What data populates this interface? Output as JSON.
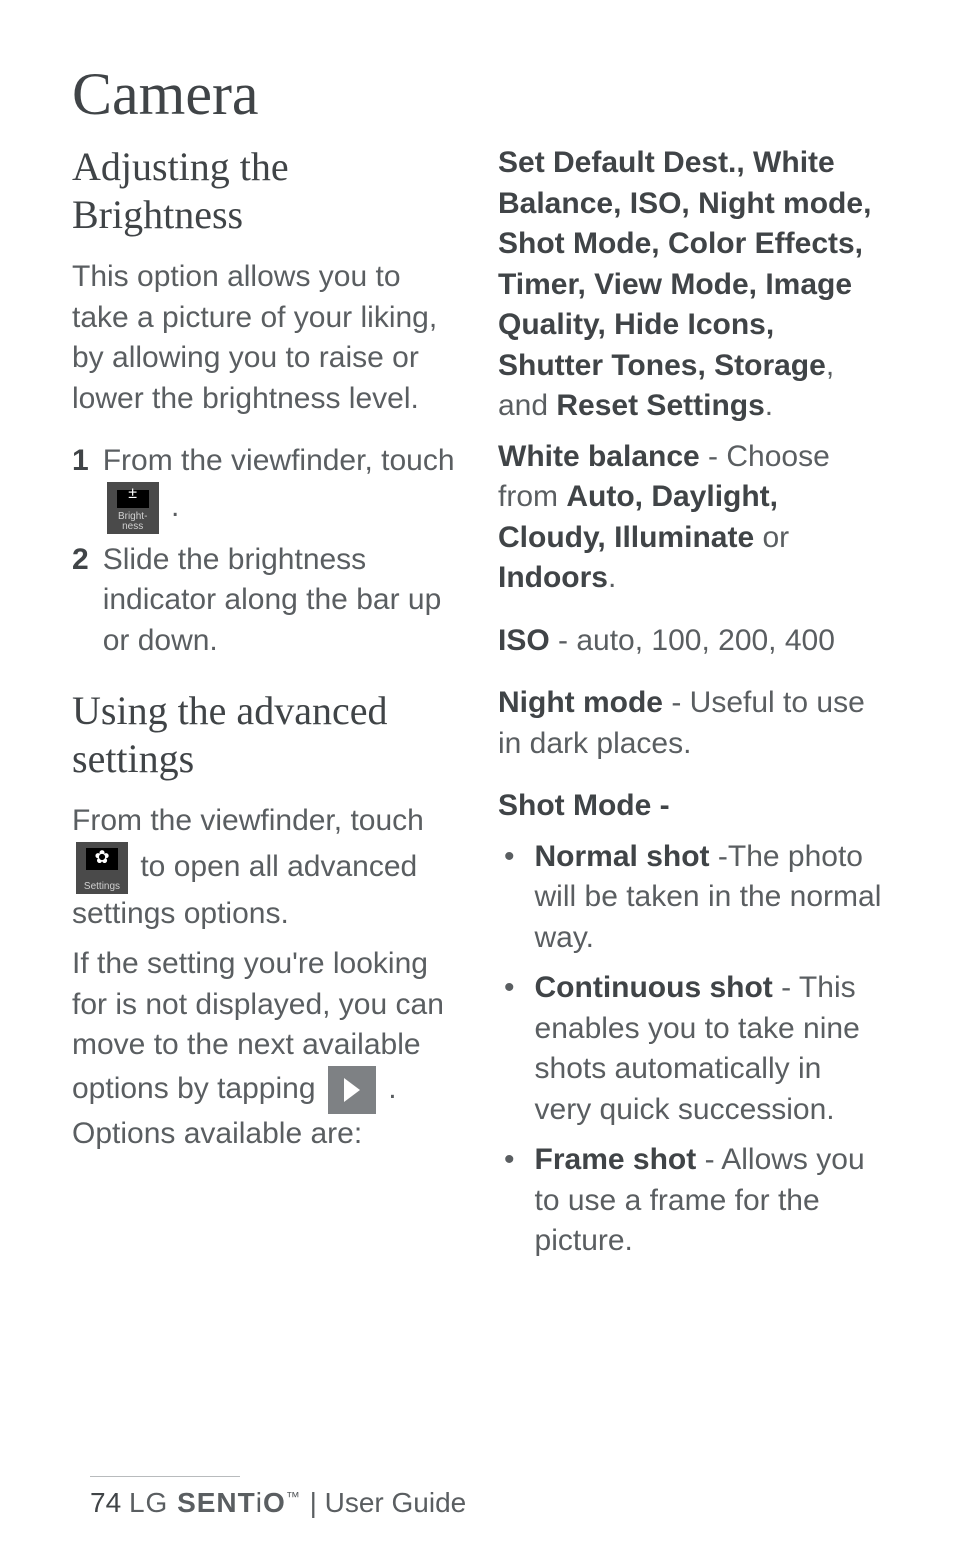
{
  "title": "Camera",
  "left": {
    "heading1": "Adjusting the Brightness",
    "intro": "This option allows you to take a picture of your liking, by allowing you to raise or lower the brightness level.",
    "step1_num": "1",
    "step1_pre": "From the viewfinder, touch ",
    "step1_post": " .",
    "brightness_icon_label": "Bright-\nness",
    "step2_num": "2",
    "step2": "Slide the brightness indicator along the bar up or down.",
    "heading2": "Using the advanced settings",
    "adv_pre": "From the viewfinder, touch ",
    "adv_mid": " to open all advanced settings options.",
    "settings_icon_label": "Settings",
    "adv2_pre": "If the setting you're looking for is not displayed, you can move to the next available options by tapping ",
    "adv2_post": " . Options available are:"
  },
  "right": {
    "opts_bold": "Set Default Dest., White Balance, ISO, Night mode, Shot Mode, Color Effects, Timer, View Mode, Image Quality, Hide Icons, Shutter Tones, Storage",
    "opts_mid": ", and ",
    "opts_bold2": "Reset Settings",
    "opts_end": ".",
    "wb_label": "White balance",
    "wb_mid": " - Choose from ",
    "wb_bold": "Auto, Daylight, Cloudy, Illuminate",
    "wb_or": " or ",
    "wb_bold2": "Indoors",
    "wb_end": ".",
    "iso_label": "ISO",
    "iso_rest": " - auto, 100, 200, 400",
    "night_label": "Night mode",
    "night_rest": " - Useful to use in dark places.",
    "shot_label": "Shot Mode -",
    "b1_label": "Normal shot",
    "b1_rest": " -The photo will be taken in the normal way.",
    "b2_label": "Continuous shot",
    "b2_rest": " - This enables you to take nine shots automatically in very quick succession.",
    "b3_label": "Frame shot",
    "b3_rest": " - Allows you to use a frame for the picture."
  },
  "footer": {
    "page": "74",
    "brand_lg": "LG",
    "brand_sent": "SENT",
    "brand_i": "i",
    "brand_o": "O",
    "brand_tm": "™",
    "sep": "  |  ",
    "guide": "User Guide"
  }
}
